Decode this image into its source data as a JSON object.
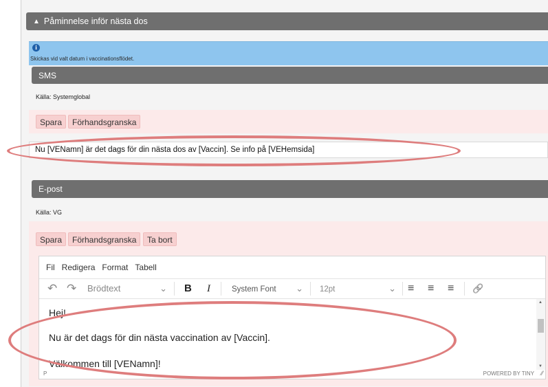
{
  "reminder": {
    "arrow": "▲",
    "title": "Påminnelse inför nästa dos"
  },
  "info": {
    "icon": "i",
    "text": "Skickas vid valt datum i vaccinationsflödet."
  },
  "sms": {
    "title": "SMS",
    "source": "Källa: Systemglobal",
    "save": "Spara",
    "preview": "Förhandsgranska",
    "message": "Nu [VENamn] är det dags för din nästa dos av [Vaccin]. Se info på [VEHemsida]"
  },
  "email": {
    "title": "E-post",
    "source": "Källa: VG",
    "save": "Spara",
    "preview": "Förhandsgranska",
    "delete": "Ta bort",
    "menu": [
      "Fil",
      "Redigera",
      "Format",
      "Tabell"
    ],
    "toolbar": {
      "undo": "↶",
      "redo": "↷",
      "block_format": "Brödtext",
      "bold": "B",
      "italic": "I",
      "font": "System Font",
      "size": "12pt",
      "align_left": "≡",
      "align_center": "≡",
      "align_right": "≡",
      "link": "🔗"
    },
    "body": [
      "Hej!",
      "Nu är det dags för din nästa vaccination av [Vaccin].",
      "Välkommen till [VENamn]!"
    ],
    "status_path": "P",
    "powered_by": "POWERED BY TINY"
  }
}
